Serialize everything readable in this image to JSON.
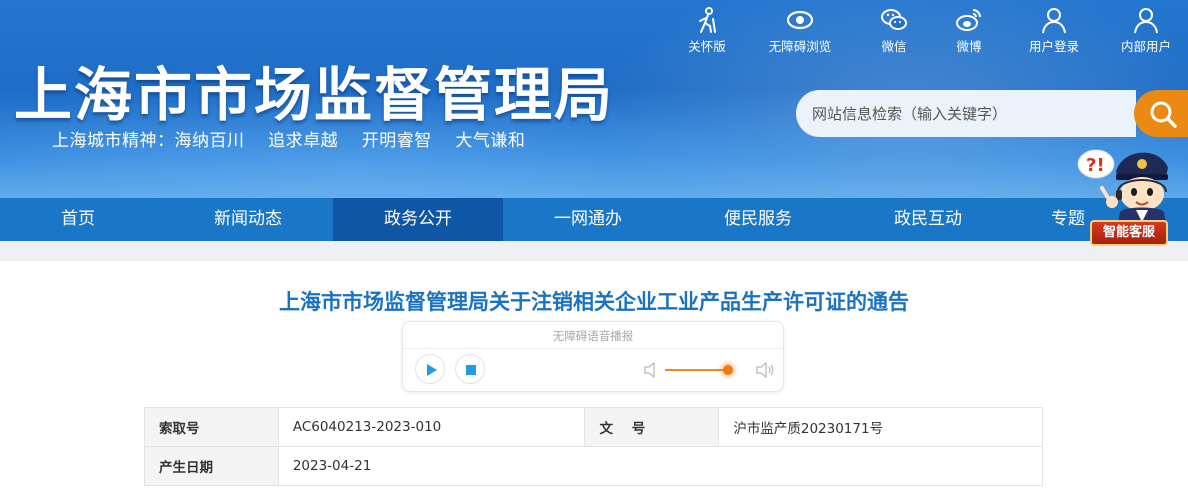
{
  "header": {
    "site_title": "上海市市场监督管理局",
    "slogan": "上海城市精神：海纳百川    追求卓越    开明睿智    大气谦和",
    "top_links": [
      {
        "label": "关怀版",
        "icon": "elderly-care-icon"
      },
      {
        "label": "无障碍浏览",
        "icon": "eye-icon"
      },
      {
        "label": "微信",
        "icon": "wechat-icon"
      },
      {
        "label": "微博",
        "icon": "weibo-icon"
      },
      {
        "label": "用户登录",
        "icon": "user-icon"
      },
      {
        "label": "内部用户",
        "icon": "user-icon"
      }
    ],
    "search": {
      "placeholder": "网站信息检索（输入关键字）",
      "value": ""
    },
    "colors": {
      "header_blue": "#1f6dc6",
      "search_orange": "#ea8a12"
    }
  },
  "nav": {
    "items": [
      {
        "label": "首页"
      },
      {
        "label": "新闻动态"
      },
      {
        "label": "政务公开",
        "active": true
      },
      {
        "label": "一网通办"
      },
      {
        "label": "便民服务"
      },
      {
        "label": "政民互动"
      },
      {
        "label": "专题"
      }
    ],
    "colors": {
      "bar": "#1a77c8",
      "active": "#0f56a5"
    }
  },
  "assistant": {
    "label": "智能客服"
  },
  "article": {
    "title": "上海市市场监督管理局关于注销相关企业工业产品生产许可证的通告",
    "title_color": "#1b72c1",
    "player": {
      "title": "无障碍语音播报",
      "volume_percent": 95
    },
    "info_rows": [
      {
        "label1": "索取号",
        "value1": "AC6040213-2023-010",
        "label2": "文    号",
        "value2": "沪市监产质20230171号"
      },
      {
        "label1": "产生日期",
        "value1": "2023-04-21"
      }
    ]
  }
}
